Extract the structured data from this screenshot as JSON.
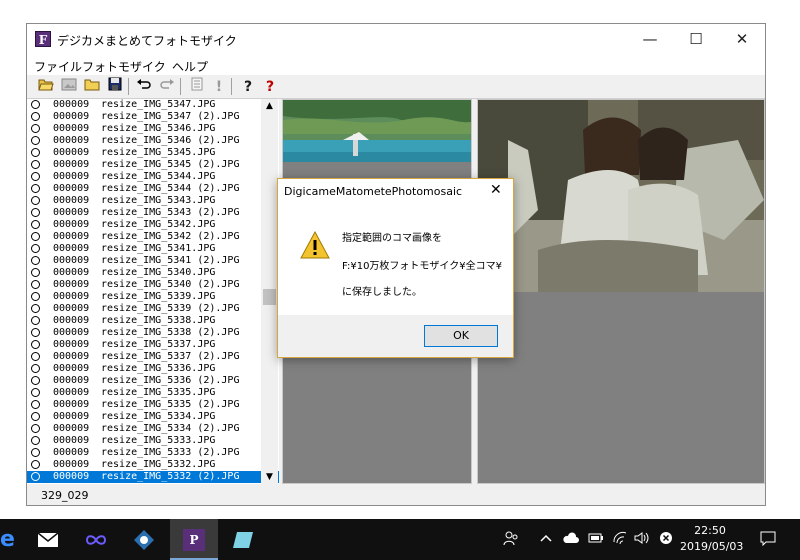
{
  "window": {
    "title": "デジカメまとめてフォトモザイク",
    "app_icon_letter": "F",
    "minimize": "—",
    "maximize": "☐",
    "close": "✕"
  },
  "menu": [
    "ファイル",
    "フォトモザイク",
    "ヘルプ"
  ],
  "toolbar": [
    "open-folder-icon",
    "image-icon",
    "folder-icon",
    "save-icon",
    "undo-icon",
    "redo-icon",
    "list-icon",
    "exclamation-icon",
    "help-icon",
    "help-red-icon"
  ],
  "file_list": [
    {
      "num": "000009",
      "name": "resize_IMG_5347.JPG"
    },
    {
      "num": "000009",
      "name": "resize_IMG_5347 (2).JPG"
    },
    {
      "num": "000009",
      "name": "resize_IMG_5346.JPG"
    },
    {
      "num": "000009",
      "name": "resize_IMG_5346 (2).JPG"
    },
    {
      "num": "000009",
      "name": "resize_IMG_5345.JPG"
    },
    {
      "num": "000009",
      "name": "resize_IMG_5345 (2).JPG"
    },
    {
      "num": "000009",
      "name": "resize_IMG_5344.JPG"
    },
    {
      "num": "000009",
      "name": "resize_IMG_5344 (2).JPG"
    },
    {
      "num": "000009",
      "name": "resize_IMG_5343.JPG"
    },
    {
      "num": "000009",
      "name": "resize_IMG_5343 (2).JPG"
    },
    {
      "num": "000009",
      "name": "resize_IMG_5342.JPG"
    },
    {
      "num": "000009",
      "name": "resize_IMG_5342 (2).JPG"
    },
    {
      "num": "000009",
      "name": "resize_IMG_5341.JPG"
    },
    {
      "num": "000009",
      "name": "resize_IMG_5341 (2).JPG"
    },
    {
      "num": "000009",
      "name": "resize_IMG_5340.JPG"
    },
    {
      "num": "000009",
      "name": "resize_IMG_5340 (2).JPG"
    },
    {
      "num": "000009",
      "name": "resize_IMG_5339.JPG"
    },
    {
      "num": "000009",
      "name": "resize_IMG_5339 (2).JPG"
    },
    {
      "num": "000009",
      "name": "resize_IMG_5338.JPG"
    },
    {
      "num": "000009",
      "name": "resize_IMG_5338 (2).JPG"
    },
    {
      "num": "000009",
      "name": "resize_IMG_5337.JPG"
    },
    {
      "num": "000009",
      "name": "resize_IMG_5337 (2).JPG"
    },
    {
      "num": "000009",
      "name": "resize_IMG_5336.JPG"
    },
    {
      "num": "000009",
      "name": "resize_IMG_5336 (2).JPG"
    },
    {
      "num": "000009",
      "name": "resize_IMG_5335.JPG"
    },
    {
      "num": "000009",
      "name": "resize_IMG_5335 (2).JPG"
    },
    {
      "num": "000009",
      "name": "resize_IMG_5334.JPG"
    },
    {
      "num": "000009",
      "name": "resize_IMG_5334 (2).JPG"
    },
    {
      "num": "000009",
      "name": "resize_IMG_5333.JPG"
    },
    {
      "num": "000009",
      "name": "resize_IMG_5333 (2).JPG"
    },
    {
      "num": "000009",
      "name": "resize_IMG_5332.JPG"
    },
    {
      "num": "000009",
      "name": "resize_IMG_5332 (2).JPG",
      "selected": true
    }
  ],
  "status": "329_029",
  "dialog": {
    "title": "DigicameMatometePhotomosaic",
    "close": "✕",
    "message_line1": "指定範囲のコマ画像を",
    "message_line2": "F:¥10万枚フォトモザイク¥全コマ¥",
    "message_line3": "に保存しました。",
    "ok_label": "OK",
    "icon": "warning-icon"
  },
  "taskbar": {
    "clock_time": "22:50",
    "clock_date": "2019/05/03"
  },
  "colors": {
    "selection": "#0078d7",
    "pane_gray": "#808080",
    "taskbar": "#101010",
    "dialog_border": "#d8a640"
  }
}
